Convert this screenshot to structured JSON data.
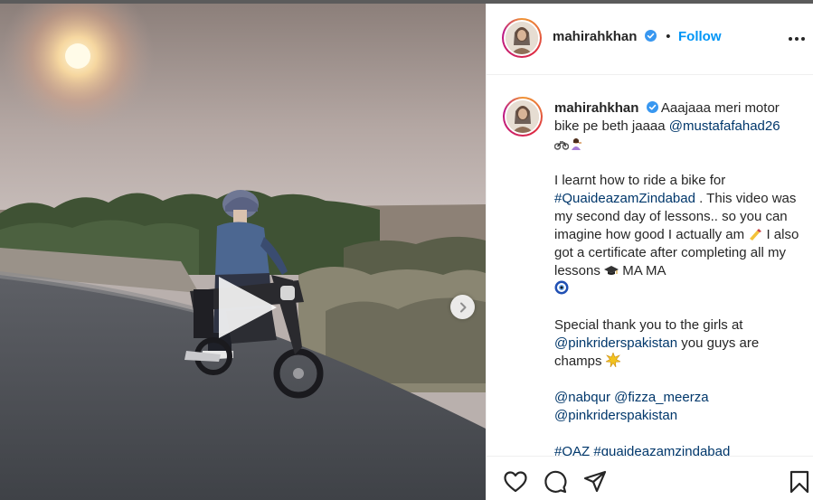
{
  "post": {
    "username": "mahirahkhan",
    "separator": "•",
    "follow_label": "Follow",
    "caption": {
      "username": "mahirahkhan",
      "line1_text": "Aaajaaa meri motor bike pe beth jaaaa ",
      "line1_mention": "@mustafafahad26",
      "p2_a": "I learnt how to ride a bike for ",
      "p2_tag": "#QuaideazamZindabad",
      "p2_b": " . This video was my second day of lessons.. so you can imagine how good I actually am ",
      "p2_c": " I also got a certificate after completing all my lessons ",
      "p2_d": " MA MA ",
      "p3_a": "Special thank you to the girls at ",
      "p3_mention": "@pinkriderspakistan",
      "p3_b": " you guys are champs ",
      "p4_m1": "@nabqur",
      "p4_m2": "@fizza_meerza",
      "p4_m3": "@pinkriderspakistan",
      "p5_t1": "#QAZ",
      "p5_t2": "#quaideazamzindabad"
    }
  },
  "icons": {
    "verified": "verified-badge-icon",
    "more": "more-options-icon",
    "play": "play-icon",
    "next": "chevron-right-icon",
    "like": "heart-icon",
    "comment": "comment-icon",
    "share": "share-icon",
    "save": "bookmark-icon"
  },
  "colors": {
    "accent": "#0095f6",
    "link": "#00376b",
    "text": "#262626"
  }
}
